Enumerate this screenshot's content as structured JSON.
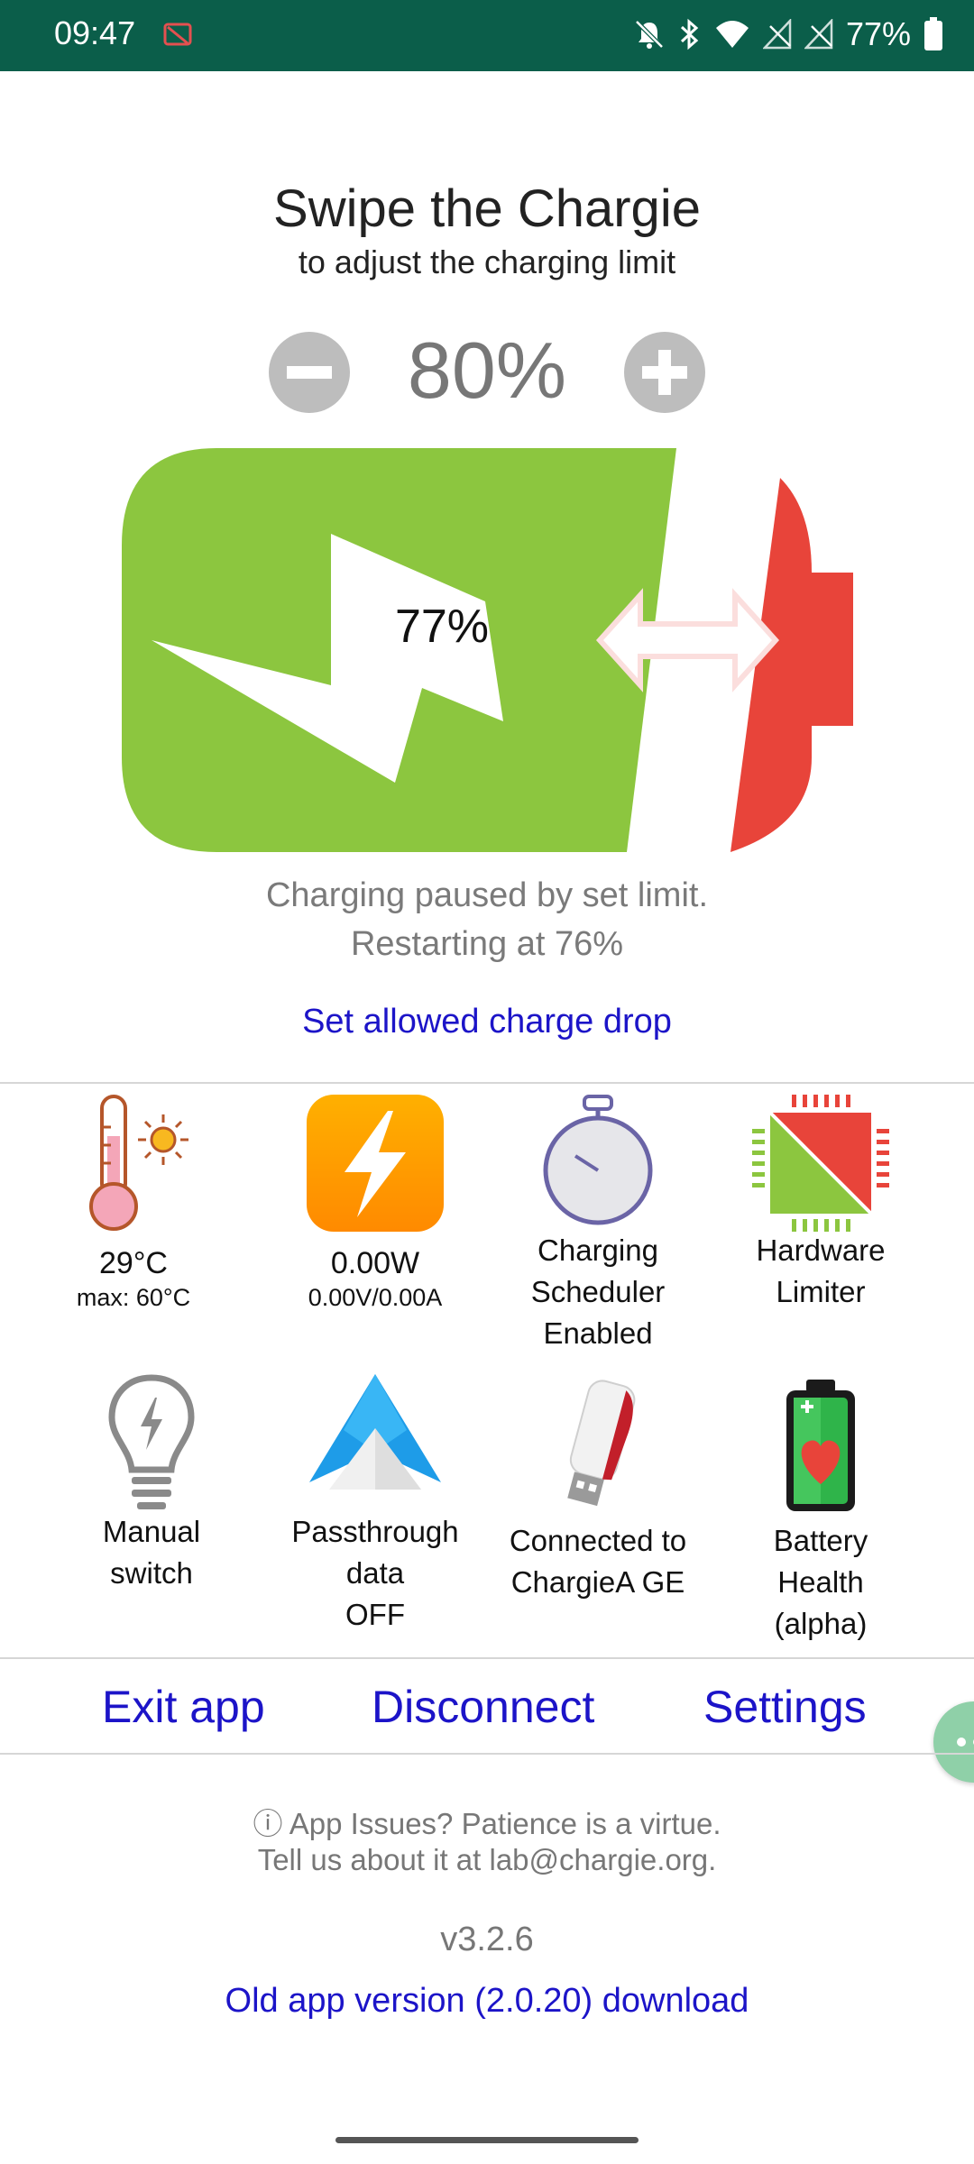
{
  "status_bar": {
    "time": "09:47",
    "battery_percent": "77%",
    "icons": [
      "screen-record-off-icon",
      "notifications-muted-icon",
      "bluetooth-icon",
      "wifi-icon",
      "no-signal-icon",
      "no-signal-icon",
      "battery-icon"
    ]
  },
  "header": {
    "title": "Swipe the Chargie",
    "subtitle": "to adjust the charging limit"
  },
  "limit": {
    "value": "80%",
    "decrease_icon": "minus-circle-icon",
    "increase_icon": "plus-circle-icon"
  },
  "battery": {
    "percent": "77%",
    "colors": {
      "fill": "#8cc63f",
      "limit": "#e8443a"
    }
  },
  "status": {
    "line1": "Charging paused by set limit.",
    "line2": "Restarting at 76%"
  },
  "charge_drop_link": "Set allowed charge drop",
  "tiles": [
    {
      "icon": "thermometer-sun-icon",
      "label": "29°C",
      "sub": "max: 60°C"
    },
    {
      "icon": "lightning-bolt-icon",
      "label": "0.00W",
      "sub": "0.00V/0.00A"
    },
    {
      "icon": "stopwatch-icon",
      "lines": [
        "Charging",
        "Scheduler",
        "Enabled"
      ]
    },
    {
      "icon": "chip-icon",
      "lines": [
        "Hardware",
        "Limiter"
      ]
    },
    {
      "icon": "lightbulb-icon",
      "lines": [
        "Manual",
        "switch"
      ]
    },
    {
      "icon": "android-auto-icon",
      "lines": [
        "Passthrough",
        "data",
        "OFF"
      ]
    },
    {
      "icon": "usb-dongle-icon",
      "lines": [
        "Connected to",
        "ChargieA GE"
      ]
    },
    {
      "icon": "battery-heart-icon",
      "lines": [
        "Battery",
        "Health",
        "(alpha)"
      ]
    }
  ],
  "actions": {
    "exit": "Exit app",
    "disconnect": "Disconnect",
    "settings": "Settings"
  },
  "info": {
    "line1": "ⓘ App Issues? Patience is a virtue.",
    "line2": "Tell us about it at lab@chargie.org."
  },
  "version": "v3.2.6",
  "old_version_link": "Old app version (2.0.20) download"
}
